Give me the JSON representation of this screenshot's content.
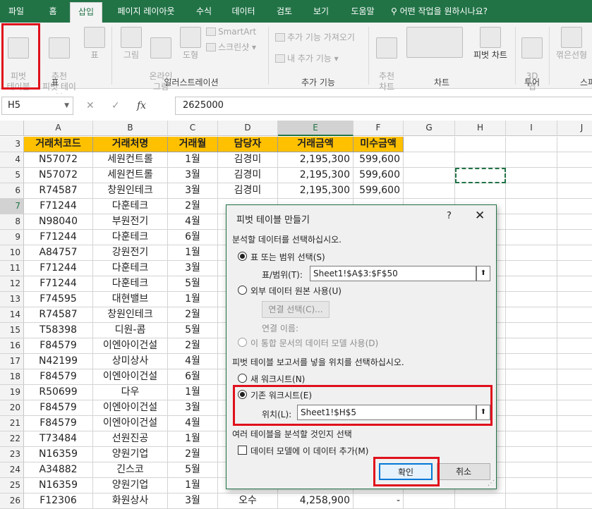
{
  "tabs": [
    "파일",
    "홈",
    "삽입",
    "페이지 레이아웃",
    "수식",
    "데이터",
    "검토",
    "보기",
    "도움말"
  ],
  "active_tab": "삽입",
  "tell_me": "어떤 작업을 원하시나요?",
  "ribbon": {
    "pivot_table": "피벗\n테이블",
    "recommended_pivot": "추천\n피벗 테이블",
    "table": "표",
    "group_table": "표",
    "pictures": "그림",
    "online_pictures": "온라인\n그림",
    "shapes": "도형",
    "smartart": "SmartArt",
    "screenshot": "스크린샷",
    "group_illustrations": "일러스트레이션",
    "get_addins": "추가 기능 가져오기",
    "my_addins": "내 추가 기능",
    "group_addins": "추가 기능",
    "recommended_charts": "추천\n차트",
    "pivot_chart": "피벗 차트",
    "group_charts": "차트",
    "map_3d": "3D\n맵",
    "group_tours": "투어",
    "sparkline_line": "꺾은선형",
    "group_sparklines": "스파"
  },
  "formula_bar": {
    "name_box": "H5",
    "cancel": "✕",
    "enter": "✓",
    "fx": "fx",
    "value": "2625000"
  },
  "columns": [
    "A",
    "B",
    "C",
    "D",
    "E",
    "F",
    "G",
    "H",
    "I",
    "J"
  ],
  "rows": [
    "3",
    "4",
    "5",
    "6",
    "7",
    "8",
    "9",
    "10",
    "11",
    "12",
    "13",
    "14",
    "15",
    "16",
    "17",
    "18",
    "19",
    "20",
    "21",
    "22",
    "23",
    "24",
    "25",
    "26"
  ],
  "table_headers": [
    "거래처코드",
    "거래처명",
    "거래월",
    "담당자",
    "거래금액",
    "미수금액"
  ],
  "table_rows": [
    [
      "N57072",
      "세원컨트롤",
      "1월",
      "김경미",
      "2,195,300",
      "599,600"
    ],
    [
      "N57072",
      "세원컨트롤",
      "3월",
      "김경미",
      "2,195,300",
      "599,600"
    ],
    [
      "R74587",
      "창원인테크",
      "3월",
      "김경미",
      "2,195,300",
      "599,600"
    ],
    [
      "F71244",
      "다훈테크",
      "2월",
      "",
      "",
      ""
    ],
    [
      "N98040",
      "부원전기",
      "4월",
      "",
      "",
      ""
    ],
    [
      "F71244",
      "다훈테크",
      "6월",
      "",
      "",
      ""
    ],
    [
      "A84757",
      "강원전기",
      "1월",
      "",
      "",
      ""
    ],
    [
      "F71244",
      "다훈테크",
      "3월",
      "",
      "",
      ""
    ],
    [
      "F71244",
      "다훈테크",
      "5월",
      "",
      "",
      ""
    ],
    [
      "F74595",
      "대현밸브",
      "1월",
      "",
      "",
      ""
    ],
    [
      "R74587",
      "창원인테크",
      "2월",
      "",
      "",
      ""
    ],
    [
      "T58398",
      "디원-콤",
      "5월",
      "",
      "",
      ""
    ],
    [
      "F84579",
      "이엔아이건설",
      "2월",
      "",
      "",
      ""
    ],
    [
      "N42199",
      "상미상사",
      "4월",
      "",
      "",
      ""
    ],
    [
      "F84579",
      "이엔아이건설",
      "6월",
      "",
      "",
      ""
    ],
    [
      "R50699",
      "다우",
      "1월",
      "",
      "",
      ""
    ],
    [
      "F84579",
      "이엔아이건설",
      "3월",
      "",
      "",
      ""
    ],
    [
      "F84579",
      "이엔아이건설",
      "4월",
      "",
      "",
      ""
    ],
    [
      "T73484",
      "선원진공",
      "1월",
      "",
      "",
      ""
    ],
    [
      "N16359",
      "양원기업",
      "2월",
      "",
      "",
      ""
    ],
    [
      "A34882",
      "긴스코",
      "5월",
      "",
      "",
      ""
    ],
    [
      "N16359",
      "양원기업",
      "1월",
      "",
      "",
      ""
    ],
    [
      "F12306",
      "화원상사",
      "3월",
      "오수",
      "4,258,900",
      "-"
    ]
  ],
  "dialog": {
    "title": "피벗 테이블 만들기",
    "help": "?",
    "close": "✕",
    "section_data": "분석할 데이터를 선택하십시오.",
    "opt_table_range": "표 또는 범위 선택(S)",
    "table_range_label": "표/범위(T):",
    "table_range_value": "Sheet1!$A$3:$F$50",
    "opt_external": "외부 데이터 원본 사용(U)",
    "choose_connection": "연결 선택(C)...",
    "connection_name": "연결 이름:",
    "opt_data_model": "이 통합 문서의 데이터 모델 사용(D)",
    "section_location": "피벗 테이블 보고서를 넣을 위치를 선택하십시오.",
    "opt_new_sheet": "새 워크시트(N)",
    "opt_existing_sheet": "기존 워크시트(E)",
    "location_label": "위치(L):",
    "location_value": "Sheet1!$H$5",
    "section_multi": "여러 테이블을 분석할 것인지 선택",
    "add_data_model": "데이터 모델에 이 데이터 추가(M)",
    "ok": "확인",
    "cancel": "취소"
  },
  "colors": {
    "excel_green": "#217346",
    "header_fill": "#ffc000",
    "highlight_red": "#e0101c"
  }
}
